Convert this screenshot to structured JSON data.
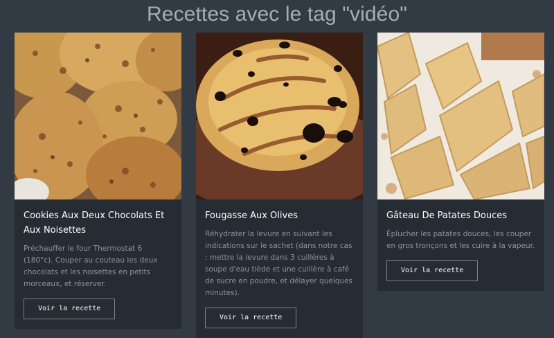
{
  "page": {
    "title": "Recettes avec le tag \"vidéo\""
  },
  "recipes": [
    {
      "title": "Cookies Aux Deux Chocolats Et Aux Noisettes",
      "description": "Préchauffer le four Thermostat 6 (180°c). Couper au couteau les deux chocolats et les noisettes en petits morceaux, et réserver.",
      "button": "Voir la recette"
    },
    {
      "title": "Fougasse Aux Olives",
      "description": "Réhydrater la levure en suivant les indications sur le sachet (dans notre cas : mettre la levure dans 3 cuillères à soupe d'eau tiède et une cuillère à café de sucre en poudre, et délayer quelques minutes).",
      "button": "Voir la recette"
    },
    {
      "title": "Gâteau De Patates Douces",
      "description": "Éplucher les patates douces, les couper en gros tronçons et les cuire à la vapeur.",
      "button": "Voir la recette"
    }
  ]
}
